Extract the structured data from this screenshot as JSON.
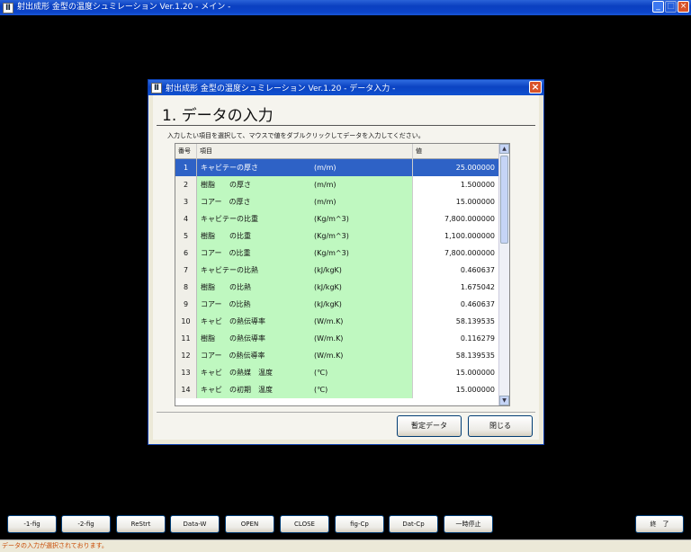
{
  "main_window": {
    "title": "射出成形 金型の温度シュミレーション Ver.1.20 - メイン -",
    "min_label": "_",
    "max_label": "□",
    "close_label": "×"
  },
  "dialog": {
    "title": "射出成形 金型の温度シュミレーション Ver.1.20 - データ入力 -",
    "close_label": "×",
    "heading": "1. データの入力",
    "instruction": "入力したい項目を選択して、マウスで値をダブルクリックしてデータを入力してください。",
    "table": {
      "headers": [
        "番号",
        "項目",
        "値"
      ],
      "rows": [
        {
          "num": "1",
          "item": "キャビテーの厚さ",
          "unit": "(m/m)",
          "value": "25.000000"
        },
        {
          "num": "2",
          "item": "樹脂　　の厚さ",
          "unit": "(m/m)",
          "value": "1.500000"
        },
        {
          "num": "3",
          "item": "コアー　の厚さ",
          "unit": "(m/m)",
          "value": "15.000000"
        },
        {
          "num": "4",
          "item": "キャビテーの比重",
          "unit": "(Kg/m^3)",
          "value": "7,800.000000"
        },
        {
          "num": "5",
          "item": "樹脂　　の比重",
          "unit": "(Kg/m^3)",
          "value": "1,100.000000"
        },
        {
          "num": "6",
          "item": "コアー　の比重",
          "unit": "(Kg/m^3)",
          "value": "7,800.000000"
        },
        {
          "num": "7",
          "item": "キャビテーの比熱",
          "unit": "(kJ/kgK)",
          "value": "0.460637"
        },
        {
          "num": "8",
          "item": "樹脂　　の比熱",
          "unit": "(kJ/kgK)",
          "value": "1.675042"
        },
        {
          "num": "9",
          "item": "コアー　の比熱",
          "unit": "(kJ/kgK)",
          "value": "0.460637"
        },
        {
          "num": "10",
          "item": "キャビ　の熱伝導率",
          "unit": "(W/m.K)",
          "value": "58.139535"
        },
        {
          "num": "11",
          "item": "樹脂　　の熱伝導率",
          "unit": "(W/m.K)",
          "value": "0.116279"
        },
        {
          "num": "12",
          "item": "コアー　の熱伝導率",
          "unit": "(W/m.K)",
          "value": "58.139535"
        },
        {
          "num": "13",
          "item": "キャビ　の熱媒　温度",
          "unit": "(℃)",
          "value": "15.000000"
        },
        {
          "num": "14",
          "item": "キャビ　の初期　温度",
          "unit": "(℃)",
          "value": "15.000000"
        }
      ],
      "selected_row": "1"
    },
    "buttons": {
      "preset_label": "暫定データ",
      "close_label": "閉じる"
    }
  },
  "toolbar": {
    "buttons": [
      "-1-fig",
      "-2-fig",
      "ReStrt",
      "Data-W",
      "OPEN",
      "CLOSE",
      "fig-Cp",
      "Dat-Cp",
      "一時停止"
    ],
    "exit_label": "終　了"
  },
  "status": {
    "text": "データの入力が選択されております。"
  }
}
